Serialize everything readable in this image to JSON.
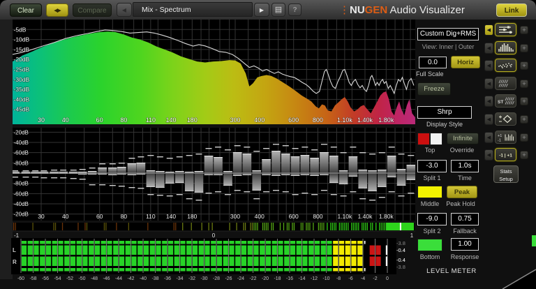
{
  "toolbar": {
    "clear": "Clear",
    "swap_icon": "◀▶",
    "compare": "Compare",
    "prev_icon": "◀",
    "preset": "Mix - Spectrum",
    "next_icon": "▶",
    "list_icon": "▤",
    "help": "?",
    "brand_dots": "⋮",
    "brand_nu": "NU",
    "brand_gen": "GEN",
    "brand_rest": " Audio Visualizer",
    "link": "Link"
  },
  "panel": {
    "custom_preset": "Custom Dig+RMS",
    "view_mode": "View: Inner | Outer",
    "offset_value": "0.0",
    "horiz": "Horiz",
    "full_scale": "Full Scale",
    "freeze": "Freeze",
    "display_style_value": "Shrp",
    "display_style": "Display Style",
    "top": "Top",
    "infinite": "Infinite",
    "override": "Override",
    "split1_value": "-3.0",
    "split1": "Split 1",
    "time_value": "1.0s",
    "time": "Time",
    "middle": "Middle",
    "peak": "Peak",
    "peak_hold": "Peak Hold",
    "split2_value": "-9.0",
    "split2": "Split 2",
    "fallback_value": "0.75",
    "fallback": "Fallback",
    "bottom": "Bottom",
    "response_value": "1.00",
    "response": "Response",
    "level_meter": "LEVEL METER",
    "colors": {
      "top_a": "#cc0f0f",
      "top_b": "#f2f2f2",
      "middle": "#f2f200",
      "bottom": "#3ade3a"
    }
  },
  "side": {
    "stats_line1": "Stats",
    "stats_line2": "Setup",
    "rows": [
      {
        "name": "view-sliders",
        "icon": "sliders",
        "active": true,
        "arrow_active": true
      },
      {
        "name": "view-bar-spectrum",
        "icon": "bars",
        "active": true,
        "arrow_active": false
      },
      {
        "name": "view-scatter",
        "icon": "scatter",
        "active": true,
        "arrow_active": false
      },
      {
        "name": "view-hatch",
        "icon": "hatch",
        "active": false,
        "arrow_active": false
      },
      {
        "name": "view-stereo-hatch",
        "icon": "st-hatch",
        "active": false,
        "arrow_active": false,
        "label": "ST"
      },
      {
        "name": "view-vectorscope",
        "icon": "diamond",
        "active": false,
        "arrow_active": false
      },
      {
        "name": "view-correlation-bars",
        "icon": "pm-bars",
        "active": false,
        "arrow_active": false,
        "label_top": "+1",
        "label_bottom": "-1"
      },
      {
        "name": "view-correlation-scale",
        "icon": "mp-text",
        "active": true,
        "arrow_active": false,
        "label": "-1 | +1"
      }
    ]
  },
  "chart_data": [
    {
      "id": "spectrum",
      "type": "area",
      "title": "Mix - Spectrum",
      "ylim": [
        0,
        -50
      ],
      "y_ticks": [
        "-5dB",
        "-10dB",
        "-15dB",
        "-20dB",
        "-25dB",
        "-30dB",
        "-35dB",
        "-40dB",
        "-45dB"
      ],
      "x_ticks": [
        {
          "f": 30,
          "l": "30"
        },
        {
          "f": 40,
          "l": "40"
        },
        {
          "f": 60,
          "l": "60"
        },
        {
          "f": 80,
          "l": "80"
        },
        {
          "f": 110,
          "l": "110"
        },
        {
          "f": 140,
          "l": "140"
        },
        {
          "f": 180,
          "l": "180"
        },
        {
          "f": 300,
          "l": "300"
        },
        {
          "f": 400,
          "l": "400"
        },
        {
          "f": 600,
          "l": "600"
        },
        {
          "f": 800,
          "l": "800"
        },
        {
          "f": 1100,
          "l": "1.10k"
        },
        {
          "f": 1400,
          "l": "1.40k"
        },
        {
          "f": 1800,
          "l": "1.80k"
        }
      ],
      "grid_freqs": [
        30,
        40,
        50,
        60,
        70,
        80,
        90,
        100,
        110,
        120,
        140,
        160,
        180,
        200,
        220,
        250,
        280,
        300,
        350,
        400,
        450,
        500,
        550,
        600,
        700,
        800,
        900,
        1000,
        1100,
        1200,
        1400,
        1600,
        1800,
        2000,
        2200,
        2400
      ],
      "gradient": [
        [
          0,
          "#00b49a"
        ],
        [
          0.07,
          "#0cc178"
        ],
        [
          0.14,
          "#1cca4e"
        ],
        [
          0.22,
          "#2bd32c"
        ],
        [
          0.32,
          "#4fd51f"
        ],
        [
          0.4,
          "#7dd31a"
        ],
        [
          0.48,
          "#a3cb16"
        ],
        [
          0.55,
          "#bcbc13"
        ],
        [
          0.63,
          "#c4a411"
        ],
        [
          0.7,
          "#c68812"
        ],
        [
          0.78,
          "#c66416"
        ],
        [
          0.85,
          "#c23a28"
        ],
        [
          0.91,
          "#c02446"
        ],
        [
          0.96,
          "#be2566"
        ],
        [
          1,
          "#ba2a7a"
        ]
      ],
      "fill_series": [
        [
          21,
          -21
        ],
        [
          24,
          -18
        ],
        [
          27,
          -16
        ],
        [
          30,
          -14
        ],
        [
          34,
          -12
        ],
        [
          38,
          -10.5
        ],
        [
          43,
          -9
        ],
        [
          48,
          -8
        ],
        [
          54,
          -7
        ],
        [
          60,
          -6.3
        ],
        [
          66,
          -6
        ],
        [
          72,
          -6.2
        ],
        [
          80,
          -7.5
        ],
        [
          88,
          -9
        ],
        [
          97,
          -10
        ],
        [
          107,
          -11.5
        ],
        [
          118,
          -13.5
        ],
        [
          130,
          -15
        ],
        [
          143,
          -16.5
        ],
        [
          158,
          -18.5
        ],
        [
          174,
          -19.8
        ],
        [
          191,
          -21
        ],
        [
          210,
          -21.5
        ],
        [
          231,
          -21
        ],
        [
          254,
          -20.8
        ],
        [
          280,
          -20.3
        ],
        [
          300,
          -20.5
        ],
        [
          320,
          -22
        ],
        [
          340,
          -27
        ],
        [
          355,
          -33.5
        ],
        [
          370,
          -32
        ],
        [
          390,
          -29
        ],
        [
          410,
          -28.3
        ],
        [
          435,
          -27.8
        ],
        [
          460,
          -28.2
        ],
        [
          490,
          -29.5
        ],
        [
          520,
          -31
        ],
        [
          550,
          -32.5
        ],
        [
          580,
          -34
        ],
        [
          620,
          -36
        ],
        [
          660,
          -38
        ],
        [
          700,
          -39.5
        ],
        [
          740,
          -41
        ],
        [
          780,
          -43.5
        ],
        [
          810,
          -44.5
        ],
        [
          840,
          -42.5
        ],
        [
          870,
          -43
        ],
        [
          900,
          -45.5
        ],
        [
          940,
          -46
        ],
        [
          980,
          -43
        ],
        [
          1020,
          -41.5
        ],
        [
          1060,
          -40
        ],
        [
          1100,
          -38.8
        ],
        [
          1140,
          -41
        ],
        [
          1180,
          -44
        ],
        [
          1230,
          -46
        ],
        [
          1280,
          -45
        ],
        [
          1330,
          -43.5
        ],
        [
          1380,
          -42.8
        ],
        [
          1440,
          -45
        ],
        [
          1500,
          -47
        ],
        [
          1560,
          -44
        ],
        [
          1620,
          -41
        ],
        [
          1680,
          -38
        ],
        [
          1740,
          -36.5
        ],
        [
          1800,
          -36
        ],
        [
          1860,
          -40
        ],
        [
          1920,
          -46
        ],
        [
          1980,
          -48
        ],
        [
          2040,
          -44
        ],
        [
          2100,
          -41
        ],
        [
          2160,
          -45
        ],
        [
          2230,
          -48
        ],
        [
          2300,
          -43
        ],
        [
          2370,
          -40
        ],
        [
          2450,
          -47
        ],
        [
          2540,
          -49
        ]
      ],
      "peak_line_series": [
        [
          21,
          -17.5
        ],
        [
          25,
          -16
        ],
        [
          30,
          -13.5
        ],
        [
          35,
          -11.5
        ],
        [
          40,
          -9.5
        ],
        [
          46,
          -8
        ],
        [
          52,
          -7
        ],
        [
          58,
          -6
        ],
        [
          64,
          -5.2
        ],
        [
          70,
          -5.5
        ],
        [
          78,
          -6
        ],
        [
          86,
          -6.8
        ],
        [
          95,
          -6.5
        ],
        [
          105,
          -6.2
        ],
        [
          115,
          -6.8
        ],
        [
          126,
          -7.8
        ],
        [
          138,
          -9
        ],
        [
          152,
          -10.5
        ],
        [
          166,
          -12
        ],
        [
          182,
          -13.3
        ],
        [
          195,
          -12.6
        ],
        [
          210,
          -13.2
        ],
        [
          228,
          -14.5
        ],
        [
          248,
          -16
        ],
        [
          268,
          -16.4
        ],
        [
          290,
          -17.5
        ],
        [
          312,
          -19.5
        ],
        [
          335,
          -22
        ],
        [
          355,
          -24
        ],
        [
          375,
          -23.2
        ],
        [
          395,
          -24.3
        ],
        [
          415,
          -25.8
        ],
        [
          435,
          -25
        ],
        [
          455,
          -26
        ],
        [
          478,
          -27
        ],
        [
          500,
          -26.2
        ],
        [
          525,
          -27.3
        ],
        [
          550,
          -28
        ],
        [
          578,
          -28.6
        ],
        [
          605,
          -29
        ],
        [
          635,
          -30.2
        ],
        [
          665,
          -31.5
        ],
        [
          695,
          -32.5
        ],
        [
          725,
          -34
        ],
        [
          755,
          -35.8
        ],
        [
          785,
          -37
        ],
        [
          815,
          -36
        ],
        [
          840,
          -31
        ],
        [
          865,
          -26
        ],
        [
          885,
          -25
        ],
        [
          905,
          -27.5
        ],
        [
          930,
          -31
        ],
        [
          955,
          -33.5
        ],
        [
          985,
          -34.5
        ],
        [
          1015,
          -31
        ],
        [
          1045,
          -28.5
        ],
        [
          1075,
          -25.5
        ],
        [
          1100,
          -25
        ],
        [
          1130,
          -28
        ],
        [
          1160,
          -31.5
        ],
        [
          1190,
          -33
        ],
        [
          1220,
          -31
        ],
        [
          1250,
          -30
        ],
        [
          1285,
          -32.5
        ],
        [
          1320,
          -34.2
        ],
        [
          1355,
          -33
        ],
        [
          1390,
          -35
        ],
        [
          1425,
          -36
        ],
        [
          1460,
          -33
        ],
        [
          1495,
          -29
        ],
        [
          1520,
          -28
        ],
        [
          1550,
          -30
        ],
        [
          1585,
          -33
        ],
        [
          1620,
          -31.5
        ],
        [
          1655,
          -33
        ],
        [
          1690,
          -31
        ],
        [
          1725,
          -30
        ],
        [
          1760,
          -32
        ],
        [
          1800,
          -31
        ],
        [
          1845,
          -34.5
        ],
        [
          1890,
          -33
        ],
        [
          1935,
          -35
        ],
        [
          1980,
          -37
        ],
        [
          2030,
          -33
        ],
        [
          2080,
          -30
        ],
        [
          2130,
          -31
        ],
        [
          2180,
          -29
        ],
        [
          2230,
          -32
        ],
        [
          2290,
          -35
        ],
        [
          2350,
          -31
        ],
        [
          2420,
          -29.5
        ],
        [
          2500,
          -33
        ]
      ]
    },
    {
      "id": "stereo-diff",
      "type": "mirror-bar",
      "y_ticks_top": [
        "-20dB",
        "-40dB",
        "-60dB",
        "-80dB"
      ],
      "y_ticks_bottom": [
        "-80dB",
        "-60dB",
        "-40dB",
        "-20dB"
      ],
      "x_ticks": [
        {
          "f": 30,
          "l": "30"
        },
        {
          "f": 40,
          "l": "40"
        },
        {
          "f": 60,
          "l": "60"
        },
        {
          "f": 80,
          "l": "80"
        },
        {
          "f": 110,
          "l": "110"
        },
        {
          "f": 140,
          "l": "140"
        },
        {
          "f": 180,
          "l": "180"
        },
        {
          "f": 300,
          "l": "300"
        },
        {
          "f": 400,
          "l": "400"
        },
        {
          "f": 600,
          "l": "600"
        },
        {
          "f": 800,
          "l": "800"
        },
        {
          "f": 1100,
          "l": "1.10k"
        },
        {
          "f": 1400,
          "l": "1.40k"
        },
        {
          "f": 1800,
          "l": "1.80k"
        }
      ],
      "bars": [
        [
          22,
          2,
          1,
          4,
          5
        ],
        [
          25,
          2,
          1,
          4,
          5
        ],
        [
          28,
          2,
          1,
          4,
          5
        ],
        [
          31,
          2,
          1,
          4,
          6
        ],
        [
          35,
          2,
          1,
          5,
          6
        ],
        [
          39,
          2,
          1,
          5,
          6
        ],
        [
          44,
          2,
          1,
          5,
          7
        ],
        [
          49,
          2,
          2,
          6,
          8
        ],
        [
          55,
          3,
          2,
          8,
          16
        ],
        [
          62,
          8,
          2,
          14,
          16
        ],
        [
          70,
          8,
          3,
          14,
          17
        ],
        [
          78,
          9,
          2,
          15,
          18
        ],
        [
          88,
          14,
          3,
          22,
          20
        ],
        [
          98,
          15,
          2,
          24,
          21
        ],
        [
          110,
          4,
          20,
          26,
          30
        ],
        [
          123,
          3,
          21,
          24,
          31
        ],
        [
          138,
          2,
          15,
          22,
          32
        ],
        [
          155,
          3,
          14,
          24,
          30
        ],
        [
          174,
          2,
          26,
          26,
          36
        ],
        [
          195,
          3,
          28,
          28,
          38
        ],
        [
          219,
          25,
          3,
          36,
          28
        ],
        [
          245,
          23,
          3,
          38,
          26
        ],
        [
          275,
          3,
          18,
          34,
          30
        ],
        [
          308,
          30,
          4,
          40,
          24
        ],
        [
          345,
          28,
          3,
          38,
          26
        ],
        [
          387,
          4,
          25,
          32,
          36
        ],
        [
          434,
          20,
          3,
          36,
          26
        ],
        [
          487,
          32,
          4,
          42,
          24
        ],
        [
          546,
          28,
          3,
          40,
          26
        ],
        [
          612,
          24,
          4,
          36,
          30
        ],
        [
          686,
          26,
          3,
          38,
          28
        ],
        [
          769,
          22,
          4,
          34,
          30
        ],
        [
          862,
          30,
          3,
          42,
          24
        ],
        [
          967,
          25,
          14,
          38,
          30
        ],
        [
          1084,
          4,
          16,
          30,
          32
        ],
        [
          1215,
          24,
          5,
          38,
          26
        ],
        [
          1363,
          5,
          22,
          30,
          36
        ],
        [
          1528,
          4,
          26,
          28,
          38
        ],
        [
          1713,
          5,
          20,
          30,
          34
        ],
        [
          1921,
          25,
          6,
          38,
          26
        ],
        [
          2154,
          6,
          18,
          28,
          32
        ],
        [
          2415,
          12,
          10,
          26,
          28
        ]
      ]
    },
    {
      "id": "correlation",
      "type": "correlation-strip",
      "axis_labels": [
        "-1",
        "0",
        "1"
      ],
      "solid_from": 0.93,
      "marker_value": 0.965
    },
    {
      "id": "level-meter",
      "type": "meter",
      "channels": [
        "L",
        "R"
      ],
      "scale_labels": [
        "-60",
        "-58",
        "-56",
        "-54",
        "-52",
        "-50",
        "-48",
        "-46",
        "-44",
        "-42",
        "-40",
        "-38",
        "-36",
        "-34",
        "-32",
        "-30",
        "-28",
        "-26",
        "-24",
        "-22",
        "-20",
        "-18",
        "-16",
        "-14",
        "-12",
        "-10",
        "-8",
        "-6",
        "-4",
        "-2",
        "0"
      ],
      "db_min": -60,
      "db_max": 0,
      "zones": {
        "green_to": -9,
        "yellow_to": -4,
        "red_from": -3,
        "red_to": -1
      },
      "peak_db": -0.25,
      "rms_db": -3.8,
      "readouts": [
        "-3.8",
        "-0.4",
        "-0.4",
        "-3.8"
      ],
      "colors": {
        "green": "#27d327",
        "yellow": "#f2ea00",
        "red": "#cc1515"
      }
    }
  ]
}
